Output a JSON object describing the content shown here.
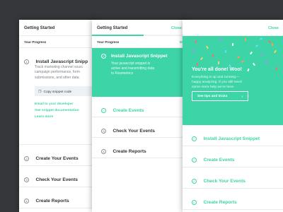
{
  "panel1": {
    "header_title": "Getting Started",
    "your_progress": "Your Progress",
    "step1": {
      "num": "1",
      "title": "Install Javascript Snipp",
      "desc_lines": [
        "Track marketing channel sourc",
        "campaign performance, form",
        "submissions, and other data."
      ],
      "copy_icon": "copy-icon",
      "copy_label": "Copy snippet code",
      "email_link": "Email to your developer",
      "docs_link": "See snippet documentation",
      "learn_link": "Learn more"
    },
    "steps": [
      {
        "num": "2",
        "title": "Create Your Events"
      },
      {
        "num": "3",
        "title": "Check Your Events"
      },
      {
        "num": "4",
        "title": "Create Reports"
      }
    ]
  },
  "panel2": {
    "header_title": "Getting Started",
    "close_label": "Close",
    "progress": 0.55,
    "your_progress": "Your Progress",
    "progress_pct": "50",
    "active_step": {
      "check": "✓",
      "title": "Install Javascript Snippet",
      "desc_lines": [
        "Your javascript snippet is",
        "active and transmitting data",
        "to Kissmetrics"
      ]
    },
    "steps": [
      {
        "check": "✓",
        "title": "Create Events",
        "done": true
      },
      {
        "num": "3",
        "title": "Check Your Events",
        "done": false
      },
      {
        "num": "4",
        "title": "Create Reports",
        "done": false
      }
    ]
  },
  "panel3": {
    "close_label": "Close",
    "done_title": "You're all done! Woo!",
    "done_desc_lines": [
      "Everything is up and running—",
      "happy analyzing. If you still need",
      "some more help we're here."
    ],
    "tips_label": "See tips and tricks",
    "tips_arrow": "›",
    "steps": [
      {
        "check": "✓",
        "title": "Install Javascript Snippet"
      },
      {
        "check": "✓",
        "title": "Create Events"
      },
      {
        "check": "✓",
        "title": "Check Your Events"
      },
      {
        "check": "✓",
        "title": "Create Reports"
      }
    ]
  },
  "colors": {
    "accent": "#3dd4a8",
    "background": "#35373b",
    "confetti": [
      "#ff6b6b",
      "#ffd35c",
      "#a78bfa",
      "#ffffff",
      "#ff9f43",
      "#5ee0ff"
    ]
  }
}
